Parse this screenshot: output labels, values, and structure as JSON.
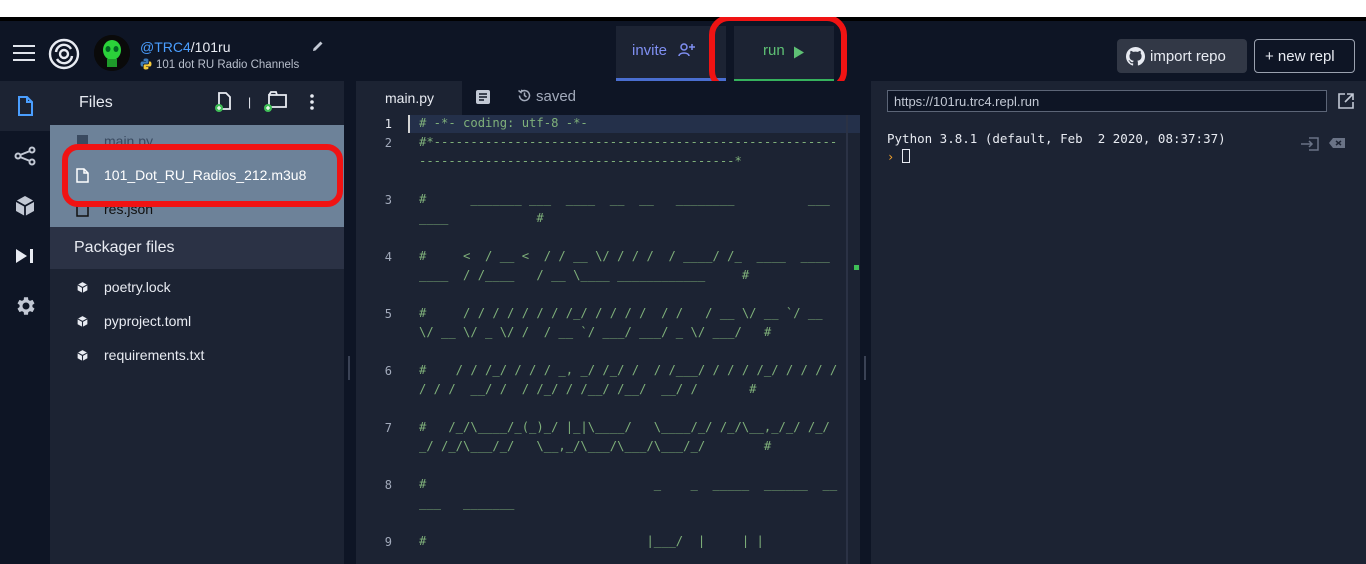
{
  "header": {
    "owner": "@TRC4",
    "separator": "/",
    "repl_name": "101ru",
    "description": "101 dot RU Radio Channels",
    "tabs": {
      "invite": "invite",
      "run": "run"
    },
    "import_label": "import repo",
    "new_label": "+ new repl"
  },
  "files": {
    "title": "Files",
    "items": [
      {
        "name": "main.py"
      },
      {
        "name": "101_Dot_RU_Radios_212.m3u8"
      },
      {
        "name": "res.json"
      }
    ],
    "packager_title": "Packager files",
    "packager_items": [
      {
        "name": "poetry.lock"
      },
      {
        "name": "pyproject.toml"
      },
      {
        "name": "requirements.txt"
      }
    ]
  },
  "editor": {
    "tab": "main.py",
    "status": "saved",
    "line_numbers": [
      "1",
      "2",
      "3",
      "4",
      "5",
      "6",
      "7",
      "8",
      "9"
    ],
    "lines": [
      "# -*- coding: utf-8 -*-",
      "#*--------------------------------------------------------------------------------------------------*",
      "#      _______ ___  ____  __  __   ________          ___       ____            #",
      "#     <  / __ <  / / __ \\/ / / /  / ____/ /_  ____  ____  ____  / /____   / __ \\____ ____________     #",
      "#     / / / / / / / /_/ / / / /  / /   / __ \\/ __ `/ __ \\/ __ \\/ _ \\/ /  / __ `/ ___/ ___/ _ \\/ ___/   #",
      "#    / / /_/ / / / _, _/ /_/ /  / /___/ / / / /_/ / / / / / / /  __/ /  / /_/ / /__/ /__/  __/ /       #",
      "#   /_/\\____/_(_)_/ |_|\\____/   \\____/_/ /_/\\__,_/_/ /_/_/ /_/\\___/_/   \\__,_/\\___/\\___/\\___/_/        #",
      "#                               _    _  _____  ______  _____   _______",
      "#                              |___/  |     | |"
    ]
  },
  "console": {
    "url": "https://101ru.trc4.repl.run",
    "output": "Python 3.8.1 (default, Feb  2 2020, 08:37:37)",
    "prompt": "›"
  }
}
